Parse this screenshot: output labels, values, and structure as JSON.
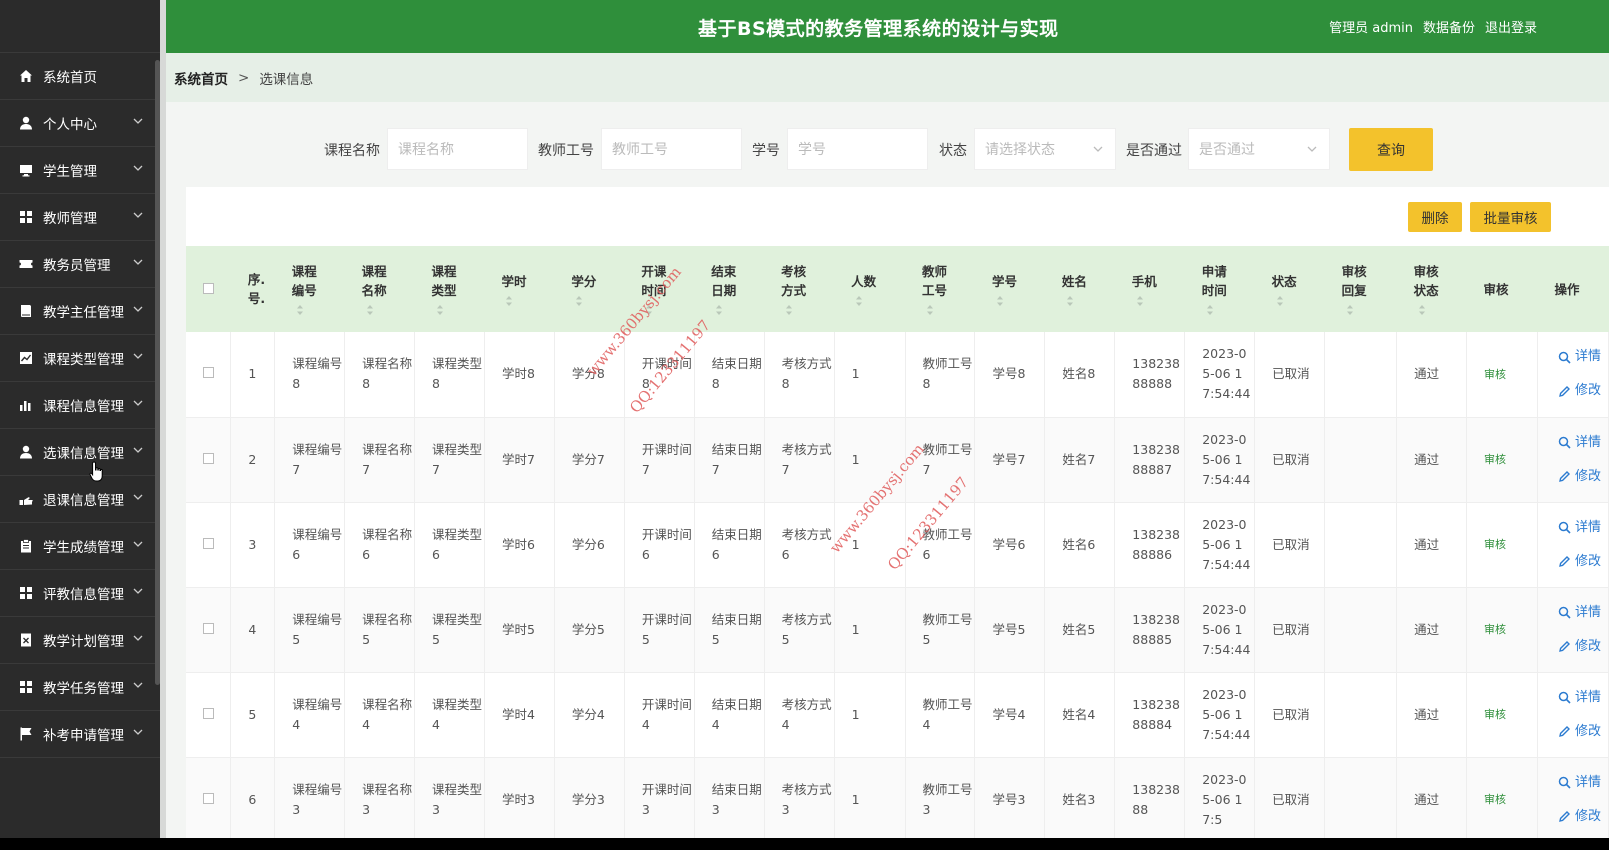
{
  "header": {
    "title": "基于BS模式的教务管理系统的设计与实现",
    "user_label": "管理员 admin",
    "backup_label": "数据备份",
    "logout_label": "退出登录"
  },
  "sidebar": {
    "items": [
      {
        "label": "系统首页",
        "icon": "home-icon"
      },
      {
        "label": "个人中心",
        "icon": "user-icon"
      },
      {
        "label": "学生管理",
        "icon": "monitor-icon"
      },
      {
        "label": "教师管理",
        "icon": "grid-icon"
      },
      {
        "label": "教务员管理",
        "icon": "ticket-icon"
      },
      {
        "label": "教学主任管理",
        "icon": "book-icon"
      },
      {
        "label": "课程类型管理",
        "icon": "chart-icon"
      },
      {
        "label": "课程信息管理",
        "icon": "bar-chart-icon"
      },
      {
        "label": "选课信息管理",
        "icon": "user-icon"
      },
      {
        "label": "退课信息管理",
        "icon": "hand-icon"
      },
      {
        "label": "学生成绩管理",
        "icon": "clipboard-icon"
      },
      {
        "label": "评教信息管理",
        "icon": "grid-icon"
      },
      {
        "label": "教学计划管理",
        "icon": "document-icon"
      },
      {
        "label": "教学任务管理",
        "icon": "grid-icon"
      },
      {
        "label": "补考申请管理",
        "icon": "flag-icon"
      }
    ]
  },
  "breadcrumb": {
    "home": "系统首页",
    "separator": ">",
    "current": "选课信息"
  },
  "search": {
    "course_name_label": "课程名称",
    "course_name_placeholder": "课程名称",
    "teacher_no_label": "教师工号",
    "teacher_no_placeholder": "教师工号",
    "student_no_label": "学号",
    "student_no_placeholder": "学号",
    "status_label": "状态",
    "status_placeholder": "请选择状态",
    "passed_label": "是否通过",
    "passed_placeholder": "是否通过",
    "query_label": "查询"
  },
  "actions": {
    "delete_label": "删除",
    "batch_audit_label": "批量审核"
  },
  "table": {
    "headers": {
      "index": [
        "序.",
        "号."
      ],
      "course_no": [
        "课程",
        "编号"
      ],
      "course_name": [
        "课程",
        "名称"
      ],
      "course_type": [
        "课程",
        "类型"
      ],
      "hours": [
        "学时"
      ],
      "credits": [
        "学分"
      ],
      "start": [
        "开课",
        "时间"
      ],
      "end": [
        "结束",
        "日期"
      ],
      "exam": [
        "考核",
        "方式"
      ],
      "count": [
        "人数"
      ],
      "teacher_no": [
        "教师",
        "工号"
      ],
      "student_no": [
        "学号"
      ],
      "name": [
        "姓名"
      ],
      "phone": [
        "手机"
      ],
      "apply_time": [
        "申请",
        "时间"
      ],
      "status": [
        "状态"
      ],
      "reply": [
        "审核",
        "回复"
      ],
      "audit_status": [
        "审核",
        "状态"
      ],
      "audit": [
        "审核"
      ],
      "ops": [
        "操作"
      ]
    },
    "rows": [
      {
        "index": "1",
        "course_no": "课程编号8",
        "course_name": "课程名称8",
        "course_type": "课程类型8",
        "hours": "学时8",
        "credits": "学分8",
        "start": "开课时间8",
        "end": "结束日期8",
        "exam": "考核方式8",
        "count": "1",
        "teacher_no": "教师工号8",
        "student_no": "学号8",
        "name": "姓名8",
        "phone": "13823888888",
        "apply_time": "2023-05-06 17:54:44",
        "status": "已取消",
        "reply": "",
        "audit_status": "通过",
        "audit": "审核",
        "detail": "详情",
        "edit": "修改"
      },
      {
        "index": "2",
        "course_no": "课程编号7",
        "course_name": "课程名称7",
        "course_type": "课程类型7",
        "hours": "学时7",
        "credits": "学分7",
        "start": "开课时间7",
        "end": "结束日期7",
        "exam": "考核方式7",
        "count": "1",
        "teacher_no": "教师工号7",
        "student_no": "学号7",
        "name": "姓名7",
        "phone": "13823888887",
        "apply_time": "2023-05-06 17:54:44",
        "status": "已取消",
        "reply": "",
        "audit_status": "通过",
        "audit": "审核",
        "detail": "详情",
        "edit": "修改"
      },
      {
        "index": "3",
        "course_no": "课程编号6",
        "course_name": "课程名称6",
        "course_type": "课程类型6",
        "hours": "学时6",
        "credits": "学分6",
        "start": "开课时间6",
        "end": "结束日期6",
        "exam": "考核方式6",
        "count": "1",
        "teacher_no": "教师工号6",
        "student_no": "学号6",
        "name": "姓名6",
        "phone": "13823888886",
        "apply_time": "2023-05-06 17:54:44",
        "status": "已取消",
        "reply": "",
        "audit_status": "通过",
        "audit": "审核",
        "detail": "详情",
        "edit": "修改"
      },
      {
        "index": "4",
        "course_no": "课程编号5",
        "course_name": "课程名称5",
        "course_type": "课程类型5",
        "hours": "学时5",
        "credits": "学分5",
        "start": "开课时间5",
        "end": "结束日期5",
        "exam": "考核方式5",
        "count": "1",
        "teacher_no": "教师工号5",
        "student_no": "学号5",
        "name": "姓名5",
        "phone": "13823888885",
        "apply_time": "2023-05-06 17:54:44",
        "status": "已取消",
        "reply": "",
        "audit_status": "通过",
        "audit": "审核",
        "detail": "详情",
        "edit": "修改"
      },
      {
        "index": "5",
        "course_no": "课程编号4",
        "course_name": "课程名称4",
        "course_type": "课程类型4",
        "hours": "学时4",
        "credits": "学分4",
        "start": "开课时间4",
        "end": "结束日期4",
        "exam": "考核方式4",
        "count": "1",
        "teacher_no": "教师工号4",
        "student_no": "学号4",
        "name": "姓名4",
        "phone": "13823888884",
        "apply_time": "2023-05-06 17:54:44",
        "status": "已取消",
        "reply": "",
        "audit_status": "通过",
        "audit": "审核",
        "detail": "详情",
        "edit": "修改"
      },
      {
        "index": "6",
        "course_no": "课程编号3",
        "course_name": "课程名称3",
        "course_type": "课程类型3",
        "hours": "学时3",
        "credits": "学分3",
        "start": "开课时间3",
        "end": "结束日期3",
        "exam": "考核方式3",
        "count": "1",
        "teacher_no": "教师工号3",
        "student_no": "学号3",
        "name": "姓名3",
        "phone": "13823888",
        "apply_time": "2023-05-06 17:5",
        "status": "已取消",
        "reply": "",
        "audit_status": "通过",
        "audit": "审核",
        "detail": "详情",
        "edit": "修改"
      }
    ]
  },
  "watermarks": [
    {
      "text": "www.360bysj.com"
    },
    {
      "text": "QQ:123311197"
    },
    {
      "text": "www.360bysj.com"
    },
    {
      "text": "QQ:123311197"
    }
  ],
  "colors": {
    "header_green": "#2f8f3b",
    "accent_yellow": "#f3c22c",
    "sidebar_dark": "#2b2b2b",
    "link_blue": "#2c7bd0"
  }
}
